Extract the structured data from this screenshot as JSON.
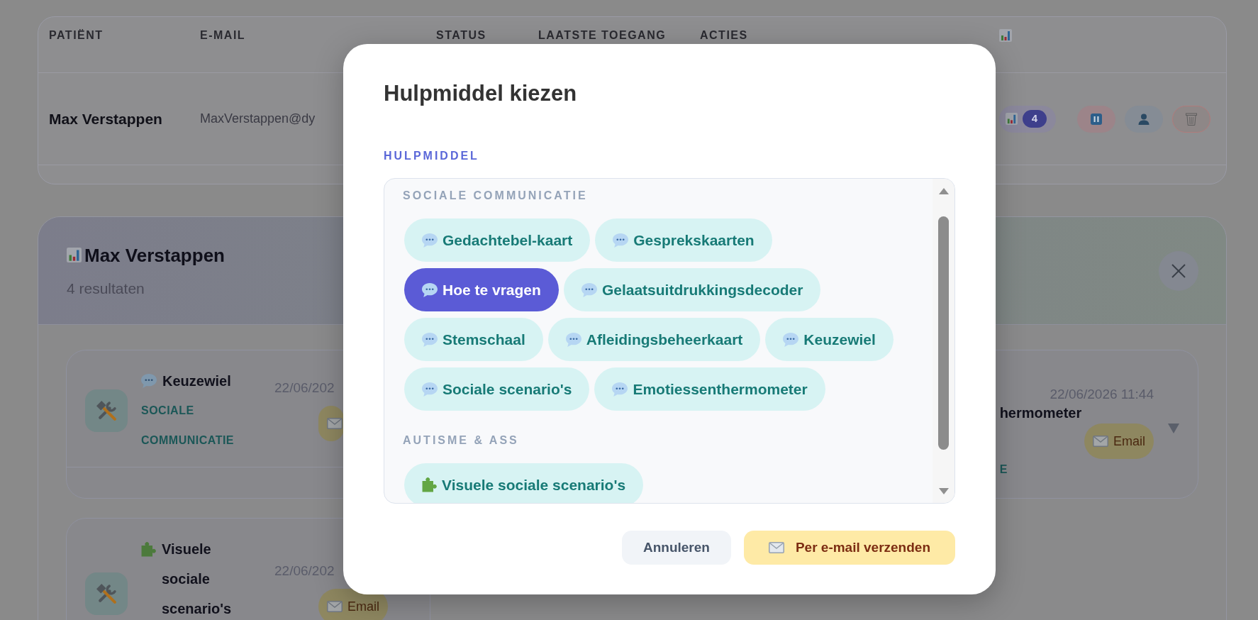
{
  "patients_table": {
    "columns": [
      {
        "kind": "text",
        "label": "PATIËNT"
      },
      {
        "kind": "text",
        "label": "E-MAIL"
      },
      {
        "kind": "text",
        "label": "STATUS"
      },
      {
        "kind": "text",
        "label": "LAATSTE TOEGANG"
      },
      {
        "kind": "text",
        "label": "ACTIES"
      },
      {
        "kind": "chart"
      }
    ],
    "rows": [
      {
        "patient": "Max Verstappen",
        "email": "MaxVerstappen@dy",
        "results_count": "4"
      }
    ]
  },
  "results_panel": {
    "title": "Max Verstappen",
    "subtitle": "4 resultaten",
    "cards": [
      {
        "kind": "speech",
        "title": "Keuzewiel",
        "category": "SOCIALE COMMUNICATIE",
        "date": "22/06/202"
      },
      {
        "kind": "cut",
        "title": "hermometer",
        "category": "E",
        "date": "22/06/2026 11:44",
        "email_label": "Email"
      },
      {
        "kind": "puzzle",
        "title": "Visuele sociale scenario's",
        "date": "22/06/202",
        "email_label": "Email"
      }
    ]
  },
  "dialog": {
    "title": "Hulpmiddel kiezen",
    "field_label": "HULPMIDDEL",
    "groups": [
      {
        "heading": "SOCIALE COMMUNICATIE",
        "kind": "speech",
        "options": [
          {
            "label": "Gedachtebel-kaart",
            "selected": false
          },
          {
            "label": "Gesprekskaarten",
            "selected": false
          },
          {
            "label": "Hoe te vragen",
            "selected": true
          },
          {
            "label": "Gelaatsuitdrukkingsdecoder",
            "selected": false
          },
          {
            "label": "Stemschaal",
            "selected": false
          },
          {
            "label": "Afleidingsbeheerkaart",
            "selected": false
          },
          {
            "label": "Keuzewiel",
            "selected": false
          },
          {
            "label": "Sociale scenario's",
            "selected": false
          },
          {
            "label": "Emotiessenthermometer",
            "selected": false
          }
        ]
      },
      {
        "heading": "AUTISME & ASS",
        "kind": "puzzle",
        "options": [
          {
            "label": "Visuele sociale scenario's",
            "selected": false
          }
        ]
      }
    ],
    "buttons": [
      {
        "kind": "secondary",
        "label": "Annuleren"
      },
      {
        "kind": "primary",
        "label": "Per e-mail verzenden"
      }
    ]
  }
}
